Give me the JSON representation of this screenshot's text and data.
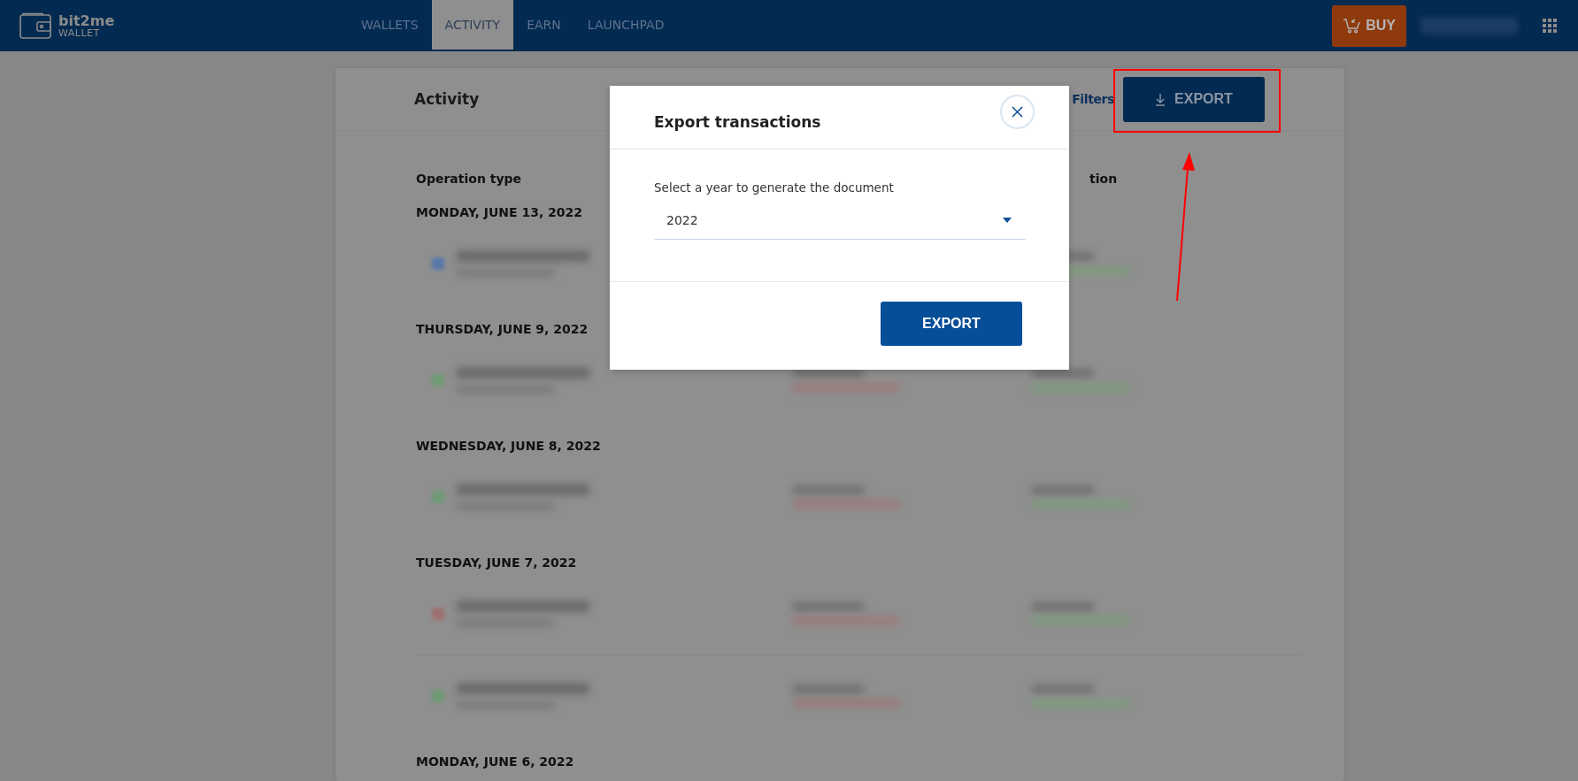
{
  "header": {
    "logo": {
      "name": "bit2me",
      "sub": "WALLET"
    },
    "nav": [
      {
        "label": "WALLETS",
        "selected": false
      },
      {
        "label": "ACTIVITY",
        "selected": true
      },
      {
        "label": "EARN",
        "selected": false
      },
      {
        "label": "LAUNCHPAD",
        "selected": false
      }
    ],
    "buy_button": "BUY"
  },
  "activity": {
    "title": "Activity",
    "filters": "Filters",
    "export_button": "EXPORT",
    "columns": [
      "Operation type",
      "tion"
    ],
    "groups": [
      {
        "date": "MONDAY, JUNE 13, 2022",
        "entries": [
          {
            "color": "#5878a8"
          }
        ]
      },
      {
        "date": "THURSDAY, JUNE 9, 2022",
        "entries": [
          {
            "color": "#6f9a74"
          }
        ]
      },
      {
        "date": "WEDNESDAY, JUNE 8, 2022",
        "entries": [
          {
            "color": "#6f9a74"
          }
        ]
      },
      {
        "date": "TUESDAY, JUNE 7, 2022",
        "entries": [
          {
            "color": "#a07070"
          },
          {
            "color": "#6f9a74"
          }
        ]
      },
      {
        "date": "MONDAY, JUNE 6, 2022"
      }
    ]
  },
  "modal": {
    "title": "Export transactions",
    "label": "Select a year to generate the document",
    "year": "2022",
    "button": "EXPORT"
  }
}
